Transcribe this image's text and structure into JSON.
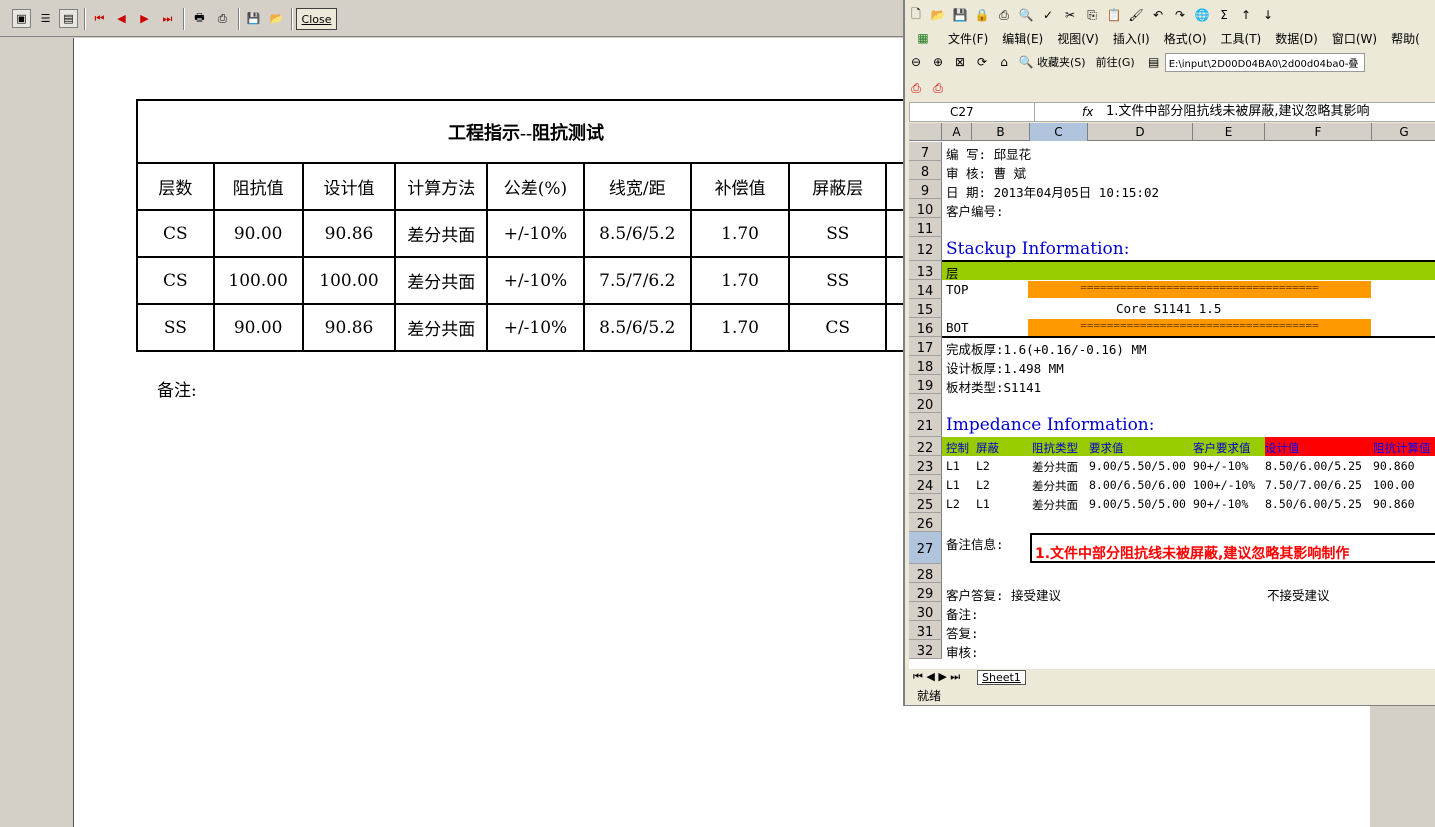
{
  "viewer": {
    "close_label": "Close",
    "toolbar_icons": [
      "page-view-icon",
      "list-view-icon",
      "page-setup-icon",
      "first-page-icon",
      "prev-page-icon",
      "next-page-icon",
      "last-page-icon",
      "print-setup-icon",
      "print-icon",
      "save-icon",
      "open-icon"
    ]
  },
  "report": {
    "title": "工程指示--阻抗测试",
    "headers": [
      "层数",
      "阻抗值",
      "设计值",
      "计算方法",
      "公差(%)",
      "线宽/距",
      "补偿值",
      "屏蔽层"
    ],
    "rows": [
      [
        "CS",
        "90.00",
        "90.86",
        "差分共面",
        "+/-10%",
        "8.5/6/5.2",
        "1.70",
        "SS"
      ],
      [
        "CS",
        "100.00",
        "100.00",
        "差分共面",
        "+/-10%",
        "7.5/7/6.2",
        "1.70",
        "SS"
      ],
      [
        "SS",
        "90.00",
        "90.86",
        "差分共面",
        "+/-10%",
        "8.5/6/5.2",
        "1.70",
        "CS"
      ]
    ],
    "remarks_label": "备注:"
  },
  "excel": {
    "menu": [
      "文件(F)",
      "编辑(E)",
      "视图(V)",
      "插入(I)",
      "格式(O)",
      "工具(T)",
      "数据(D)",
      "窗口(W)",
      "帮助("
    ],
    "nav": {
      "favorites": "收藏夹(S)",
      "go": "前往(G)",
      "address": "E:\\input\\2D00D04BA0\\2d00d04ba0-叠"
    },
    "namebox": "C27",
    "fx": "fx",
    "formula": "1.文件中部分阻抗线未被屏蔽,建议忽略其影响",
    "columns": [
      "A",
      "B",
      "C",
      "D",
      "E",
      "F",
      "G"
    ],
    "rows": [
      {
        "n": "7",
        "text": "编    写: 邱显花"
      },
      {
        "n": "8",
        "text": "审    核: 曹  斌"
      },
      {
        "n": "9",
        "text": "日    期: 2013年04月05日 10:15:02"
      },
      {
        "n": "10",
        "text": "客户编号:"
      },
      {
        "n": "11",
        "text": ""
      },
      {
        "n": "12",
        "text": "Stackup Information:"
      },
      {
        "n": "13",
        "text": "层"
      },
      {
        "n": "14",
        "text": "TOP"
      },
      {
        "n": "15",
        "text": "Core      S1141    1.5"
      },
      {
        "n": "16",
        "text": "BOT"
      },
      {
        "n": "17",
        "text": "完成板厚:1.6(+0.16/-0.16) MM"
      },
      {
        "n": "18",
        "text": "设计板厚:1.498 MM"
      },
      {
        "n": "19",
        "text": "板材类型:S1141"
      },
      {
        "n": "20",
        "text": ""
      },
      {
        "n": "21",
        "text": "Impedance Information:"
      },
      {
        "n": "22",
        "text": ""
      },
      {
        "n": "23",
        "text": ""
      },
      {
        "n": "24",
        "text": ""
      },
      {
        "n": "25",
        "text": ""
      },
      {
        "n": "26",
        "text": ""
      },
      {
        "n": "27",
        "text": "备注信息:"
      },
      {
        "n": "28",
        "text": ""
      },
      {
        "n": "29",
        "text": "客户答复:  接受建议"
      },
      {
        "n": "30",
        "text": "备注:"
      },
      {
        "n": "31",
        "text": "答复:"
      },
      {
        "n": "32",
        "text": "审核:"
      }
    ],
    "stack_bar": "====================================",
    "imp_header": [
      "控制",
      "屏蔽",
      "阻抗类型",
      "要求值",
      "客户要求值",
      "设计值",
      "阻抗计算值"
    ],
    "imp_rows": [
      [
        "L1",
        "L2",
        "差分共面",
        "9.00/5.50/5.00",
        "90+/-10%",
        "8.50/6.00/5.25",
        "90.860"
      ],
      [
        "L1",
        "L2",
        "差分共面",
        "8.00/6.50/6.00",
        "100+/-10%",
        "7.50/7.00/6.25",
        "100.00"
      ],
      [
        "L2",
        "L1",
        "差分共面",
        "9.00/5.50/5.00",
        "90+/-10%",
        "8.50/6.00/5.25",
        "90.860"
      ]
    ],
    "note_value": "1.文件中部分阻抗线未被屏蔽,建议忽略其影响制作",
    "reject_label": "不接受建议",
    "sheet_tab": "Sheet1",
    "status": "就绪",
    "colors": {
      "green": "#99cc00",
      "orange": "#ff9900",
      "red": "#ff0000",
      "blue": "#0000cc"
    }
  }
}
